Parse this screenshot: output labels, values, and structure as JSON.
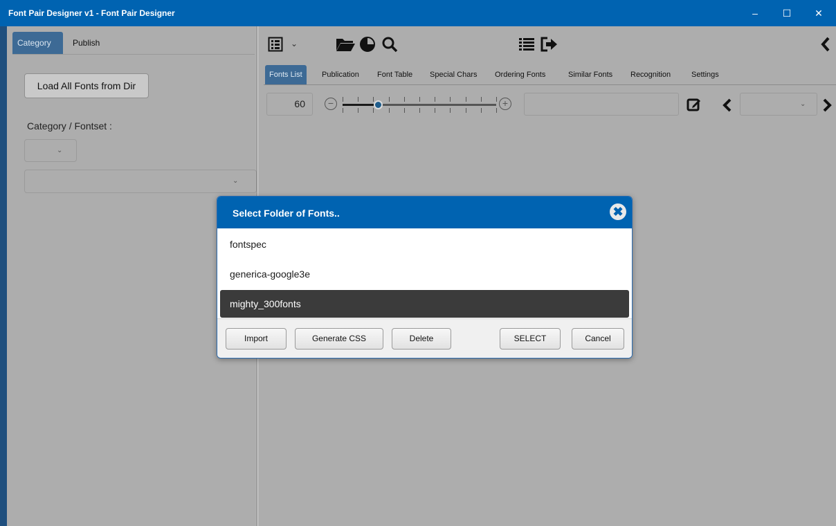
{
  "window": {
    "title": "Font Pair Designer v1 - Font Pair Designer",
    "minimize_glyph": "–",
    "maximize_glyph": "☐",
    "close_glyph": "✕"
  },
  "left_panel": {
    "tabs": [
      {
        "label": "Category",
        "active": true
      },
      {
        "label": "Publish",
        "active": false
      }
    ],
    "load_button": "Load All Fonts from Dir",
    "category_label": "Category / Fontset :",
    "category_select_value": "",
    "fontset_select_value": ""
  },
  "toolbar": {
    "icons": [
      "list-view-icon",
      "dropdown-chevron-icon",
      "folder-open-icon",
      "contrast-icon",
      "search-icon",
      "bullet-list-icon",
      "export-icon",
      "collapse-left-icon"
    ]
  },
  "main_tabs": [
    {
      "label": "Fonts List",
      "active": true
    },
    {
      "label": "Publication",
      "active": false
    },
    {
      "label": "Font Table",
      "active": false
    },
    {
      "label": "Special Chars",
      "active": false
    },
    {
      "label": "Ordering Fonts",
      "active": false
    },
    {
      "label": "Similar Fonts",
      "active": false
    },
    {
      "label": "Recognition",
      "active": false
    },
    {
      "label": "Settings",
      "active": false
    }
  ],
  "size_control": {
    "value": "60",
    "slider_fraction": 0.23,
    "text_value": "",
    "page_select_value": ""
  },
  "dialog": {
    "title": "Select Folder of Fonts..",
    "items": [
      {
        "label": "fontspec",
        "selected": false
      },
      {
        "label": "generica-google3e",
        "selected": false
      },
      {
        "label": "mighty_300fonts",
        "selected": true
      }
    ],
    "buttons": {
      "import": "Import",
      "generate_css": "Generate CSS",
      "delete": "Delete",
      "select": "SELECT",
      "cancel": "Cancel"
    }
  },
  "colors": {
    "accent": "#0063b1",
    "tab_active": "#3d6a95",
    "selected_row": "#3b3b3b"
  }
}
